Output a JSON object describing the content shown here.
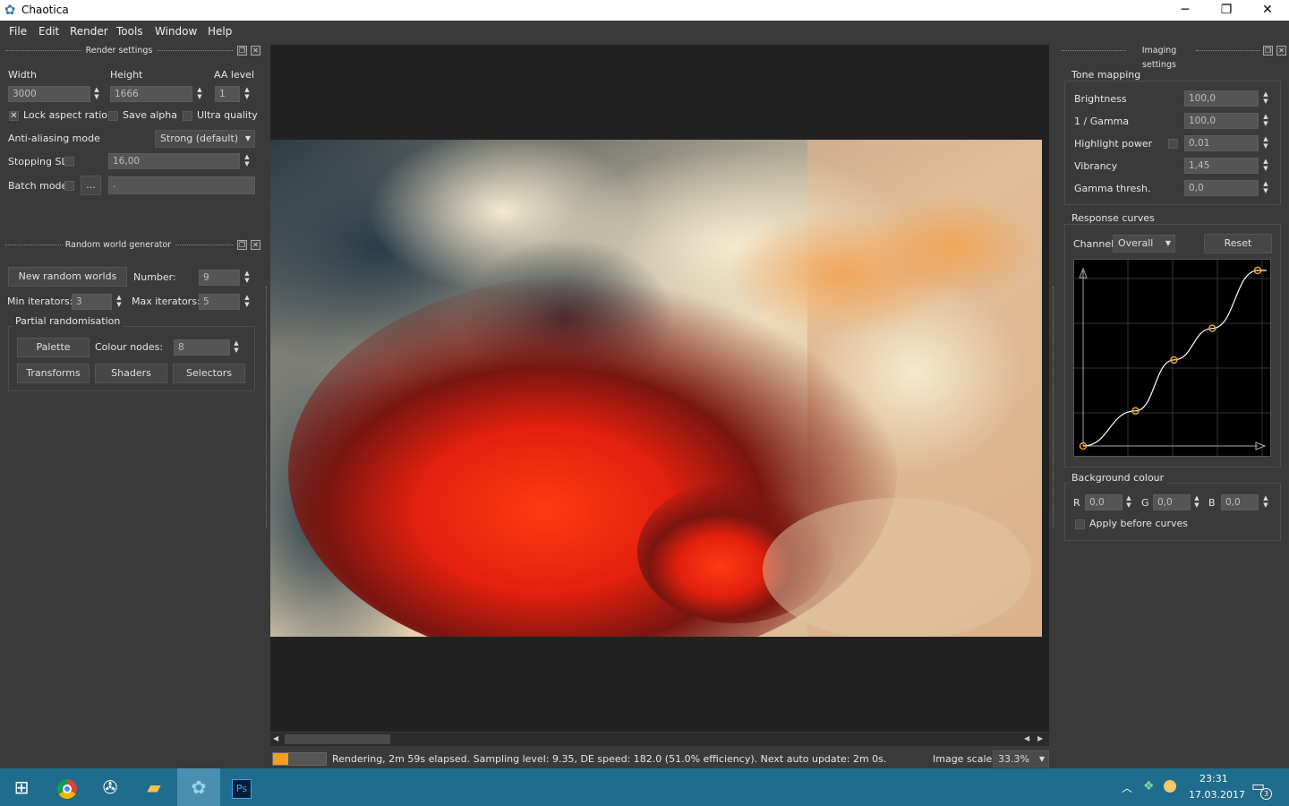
{
  "window": {
    "title": "Chaotica"
  },
  "menu": [
    "File",
    "Edit",
    "Render",
    "Tools",
    "Window",
    "Help"
  ],
  "render_settings": {
    "title": "Render settings",
    "width_label": "Width",
    "width_value": "3000",
    "height_label": "Height",
    "height_value": "1666",
    "aa_label": "AA level",
    "aa_value": "1",
    "lock_aspect": "Lock aspect ratio",
    "save_alpha": "Save alpha",
    "ultra_quality": "Ultra quality",
    "aa_mode_label": "Anti-aliasing mode",
    "aa_mode_value": "Strong (default)",
    "stopping_sl_label": "Stopping SL",
    "stopping_sl_value": "16,00",
    "batch_label": "Batch mode",
    "batch_browse": "...",
    "batch_value": "."
  },
  "random_world": {
    "title": "Random world generator",
    "new_button": "New random worlds",
    "number_label": "Number:",
    "number_value": "9",
    "min_label": "Min iterators:",
    "min_value": "3",
    "max_label": "Max iterators:",
    "max_value": "5",
    "partial_title": "Partial randomisation",
    "palette": "Palette",
    "colour_nodes_label": "Colour nodes:",
    "colour_nodes_value": "8",
    "transforms": "Transforms",
    "shaders": "Shaders",
    "selectors": "Selectors"
  },
  "imaging": {
    "title": "Imaging settings",
    "tone_title": "Tone mapping",
    "brightness_label": "Brightness",
    "brightness_value": "100,0",
    "gamma_label": "1 / Gamma",
    "gamma_value": "100,0",
    "highlight_label": "Highlight power",
    "highlight_value": "0,01",
    "vibrancy_label": "Vibrancy",
    "vibrancy_value": "1,45",
    "gthresh_label": "Gamma thresh.",
    "gthresh_value": "0,0",
    "curves_title": "Response curves",
    "channel_label": "Channel:",
    "channel_value": "Overall",
    "reset": "Reset",
    "curve_points": [
      [
        0,
        0
      ],
      [
        0.3,
        0.2
      ],
      [
        0.52,
        0.49
      ],
      [
        0.74,
        0.67
      ],
      [
        1,
        1
      ]
    ],
    "bg_title": "Background colour",
    "r_label": "R",
    "r_value": "0,0",
    "g_label": "G",
    "g_value": "0,0",
    "b_label": "B",
    "b_value": "0,0",
    "apply_before": "Apply before curves"
  },
  "status": {
    "progress": 0.28,
    "text": "Rendering, 2m 59s elapsed. Sampling level: 9.35, DE speed: 182.0 (51.0% efficiency). Next auto update: 2m 0s.",
    "scale_label": "Image scale:",
    "scale_value": "33.3%"
  },
  "taskbar": {
    "time": "23:31",
    "date": "17.03.2017",
    "notif_count": "3",
    "ps": "Ps"
  },
  "colors": {
    "accent": "#f0a020",
    "taskbar": "#1f6c8c"
  }
}
